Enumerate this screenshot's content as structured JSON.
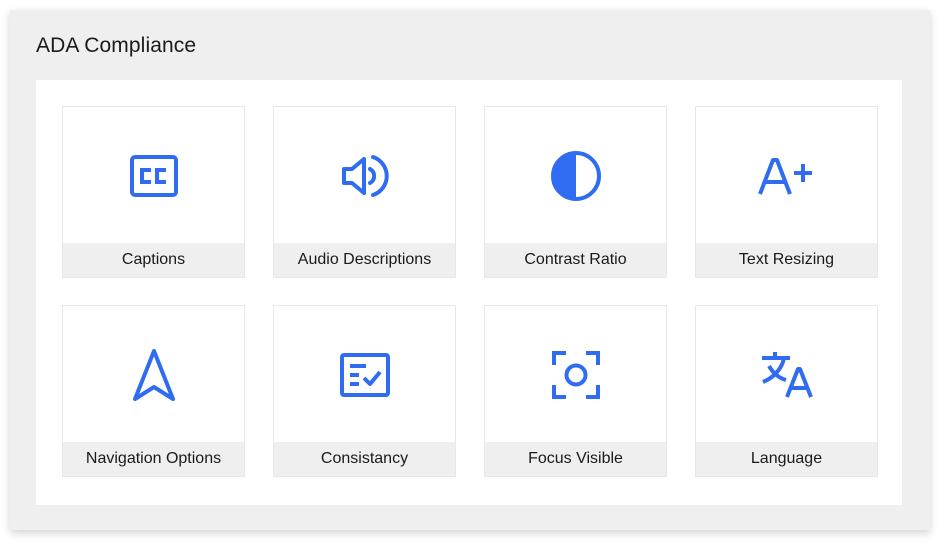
{
  "title": "ADA Compliance",
  "accent_color": "#2f6cf2",
  "cards": [
    {
      "label": "Captions",
      "icon": "closed-captions-icon"
    },
    {
      "label": "Audio Descriptions",
      "icon": "speaker-icon"
    },
    {
      "label": "Contrast Ratio",
      "icon": "contrast-icon"
    },
    {
      "label": "Text Resizing",
      "icon": "text-resize-icon"
    },
    {
      "label": "Navigation Options",
      "icon": "navigation-arrow-icon"
    },
    {
      "label": "Consistancy",
      "icon": "checklist-icon"
    },
    {
      "label": "Focus Visible",
      "icon": "focus-icon"
    },
    {
      "label": "Language",
      "icon": "translate-icon"
    }
  ]
}
